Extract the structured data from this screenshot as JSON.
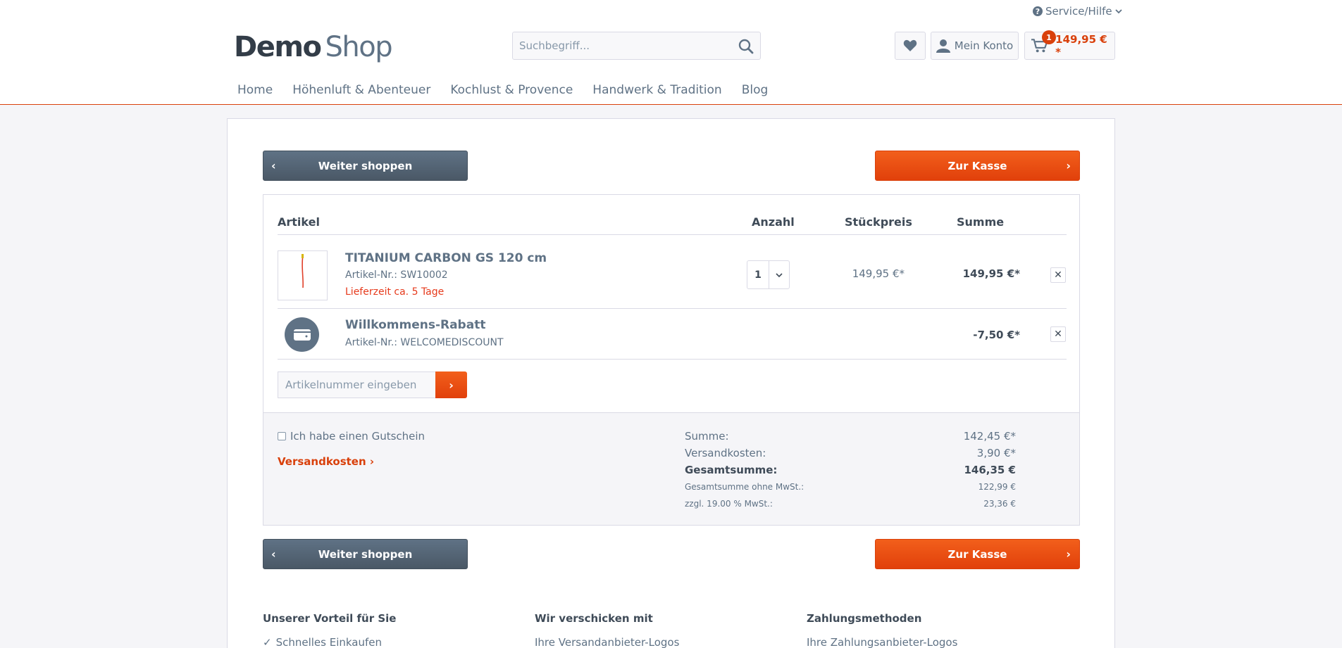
{
  "header": {
    "service_label": "Service/Hilfe",
    "logo_bold": "Demo",
    "logo_light": "Shop",
    "search_placeholder": "Suchbegriff...",
    "account_label": "Mein Konto",
    "cart_count": "1",
    "cart_amount": "149,95 € *"
  },
  "nav": {
    "items": [
      {
        "label": "Home"
      },
      {
        "label": "Höhenluft & Abenteuer"
      },
      {
        "label": "Kochlust & Provence"
      },
      {
        "label": "Handwerk & Tradition"
      },
      {
        "label": "Blog"
      }
    ]
  },
  "actions": {
    "continue_label": "Weiter shoppen",
    "checkout_label": "Zur Kasse"
  },
  "table": {
    "headers": {
      "article": "Artikel",
      "qty": "Anzahl",
      "unit_price": "Stückpreis",
      "sum": "Summe"
    },
    "items": [
      {
        "name": "TITANIUM CARBON GS 120 cm",
        "number": "Artikel-Nr.: SW10002",
        "delivery": "Lieferzeit ca. 5 Tage",
        "qty": "1",
        "unit_price": "149,95 €*",
        "sum": "149,95 €*"
      },
      {
        "name": "Willkommens-Rabatt",
        "number": "Artikel-Nr.: WELCOMEDISCOUNT",
        "sum": "-7,50 €*"
      }
    ],
    "add_placeholder": "Artikelnummer eingeben"
  },
  "summary": {
    "voucher_label": "Ich habe einen Gutschein",
    "shipping_link": "Versandkosten",
    "rows": [
      {
        "label": "Summe:",
        "value": "142,45 €*"
      },
      {
        "label": "Versandkosten:",
        "value": "3,90 €*"
      },
      {
        "label": "Gesamtsumme:",
        "value": "146,35 €"
      },
      {
        "label": "Gesamtsumme ohne MwSt.:",
        "value": "122,99 €"
      },
      {
        "label": "zzgl. 19.00 % MwSt.:",
        "value": "23,36 €"
      }
    ]
  },
  "footer": {
    "col1": {
      "title": "Unserer Vorteil für Sie",
      "item": "Schnelles Einkaufen"
    },
    "col2": {
      "title": "Wir verschicken mit",
      "item": "Ihre Versandanbieter-Logos"
    },
    "col3": {
      "title": "Zahlungsmethoden",
      "item": "Ihre Zahlungsanbieter-Logos"
    }
  },
  "colors": {
    "accent": "#d9400b",
    "dark_button": "#5f7285",
    "text": "#5f7285"
  },
  "icons": [
    "question-circle-icon",
    "chevron-down-icon",
    "search-icon",
    "heart-icon",
    "user-icon",
    "cart-icon",
    "close-icon",
    "voucher-icon",
    "checkmark-icon"
  ]
}
